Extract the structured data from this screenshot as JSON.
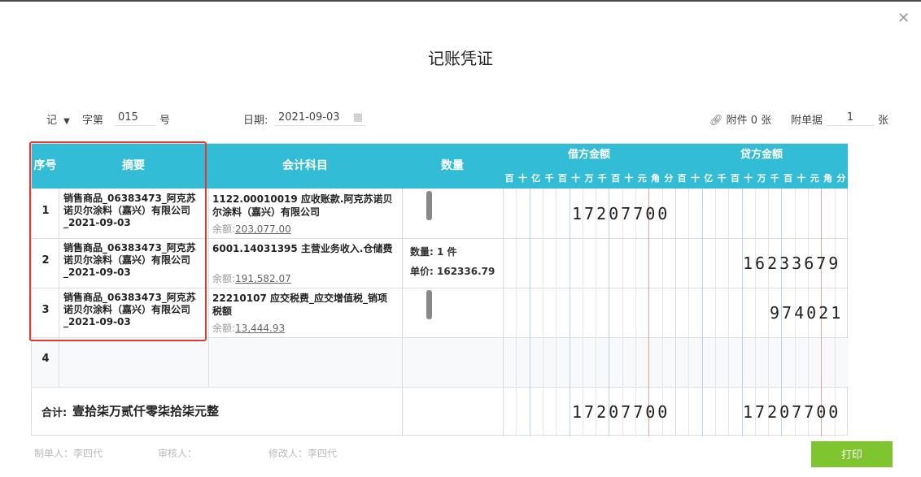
{
  "title": "记账凭证",
  "header": {
    "voucher_type": "记",
    "zi_di_label": "字第",
    "number": "015",
    "hao_label": "号",
    "date_label": "日期:",
    "date_value": "2021-09-03",
    "attach_label": "附件 0 张",
    "attach_docs_label": "附单据",
    "attach_docs_count": "1",
    "zhang_label": "张"
  },
  "table": {
    "headers": {
      "seq": "序号",
      "summary": "摘要",
      "account": "会计科目",
      "quantity": "数量",
      "debit": "借方金额",
      "credit": "贷方金额"
    },
    "digit_units": [
      "百",
      "十",
      "亿",
      "千",
      "百",
      "十",
      "万",
      "千",
      "百",
      "十",
      "元",
      "角",
      "分"
    ],
    "rows": [
      {
        "seq": "1",
        "summary": "销售商品_06383473_阿克苏诺贝尔涂料（嘉兴）有限公司_2021-09-03",
        "account": "1122.00010019 应收账款.阿克苏诺贝尔涂料（嘉兴）有限公司",
        "balance_label": "余额:",
        "balance": "203,077.00",
        "debit": "17207700",
        "credit": ""
      },
      {
        "seq": "2",
        "summary": "销售商品_06383473_阿克苏诺贝尔涂料（嘉兴）有限公司_2021-09-03",
        "account": "6001.14031395 主营业务收入.仓储费",
        "balance_label": "余额:",
        "balance": "191,582.07",
        "qty_label": "数量:",
        "qty_value": "1 件",
        "price_label": "单价:",
        "price_value": "162336.79",
        "debit": "",
        "credit": "16233679"
      },
      {
        "seq": "3",
        "summary": "销售商品_06383473_阿克苏诺贝尔涂料（嘉兴）有限公司_2021-09-03",
        "account": "22210107 应交税费_应交增值税_销项税额",
        "balance_label": "余额:",
        "balance": "13,444.93",
        "debit": "",
        "credit": "974021"
      },
      {
        "seq": "4",
        "summary": "",
        "account": "",
        "debit": "",
        "credit": ""
      }
    ],
    "total_label": "合计:",
    "total_text": "壹拾柒万贰仟零柒拾柒元整",
    "total_debit": "17207700",
    "total_credit": "17207700"
  },
  "footer": {
    "maker": "制单人：李四代",
    "reviewer": "审核人：",
    "modifier": "修改人：李四代",
    "print_label": "打印"
  },
  "colors": {
    "header_bg": "#33bcd6",
    "highlight_border": "#e53935",
    "print_bg": "#7fc52f"
  }
}
